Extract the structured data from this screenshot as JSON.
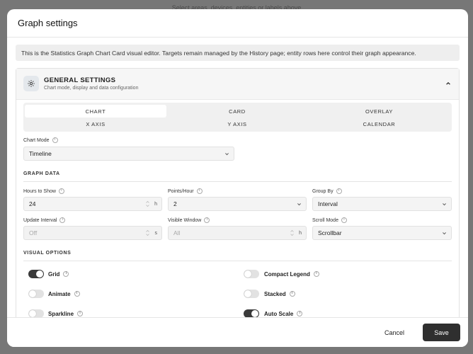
{
  "backdrop": {
    "hint_text": "Select areas, devices, entities or labels above"
  },
  "dialog": {
    "title": "Graph settings",
    "info_text": "This is the Statistics Graph Chart Card visual editor. Targets remain managed by the History page; entity rows here control their graph appearance."
  },
  "section": {
    "title": "GENERAL SETTINGS",
    "subtitle": "Chart mode, display and data configuration",
    "icon": "gear-icon",
    "collapse_icon": "chevron-up-icon"
  },
  "tabs": [
    {
      "label": "CHART",
      "active": true
    },
    {
      "label": "CARD",
      "active": false
    },
    {
      "label": "OVERLAY",
      "active": false
    },
    {
      "label": "X AXIS",
      "active": false
    },
    {
      "label": "Y AXIS",
      "active": false
    },
    {
      "label": "CALENDAR",
      "active": false
    }
  ],
  "chart_mode": {
    "label": "Chart Mode",
    "value": "Timeline"
  },
  "graph_data": {
    "title": "GRAPH DATA",
    "hours_to_show": {
      "label": "Hours to Show",
      "value": "24",
      "suffix": "h"
    },
    "points_per_hour": {
      "label": "Points/Hour",
      "value": "2"
    },
    "group_by": {
      "label": "Group By",
      "value": "Interval"
    },
    "update_interval": {
      "label": "Update Interval",
      "placeholder": "Off",
      "suffix": "s"
    },
    "visible_window": {
      "label": "Visible Window",
      "placeholder": "All",
      "suffix": "h"
    },
    "scroll_mode": {
      "label": "Scroll Mode",
      "value": "Scrollbar"
    }
  },
  "visual_options": {
    "title": "VISUAL OPTIONS",
    "toggles": [
      {
        "label": "Grid",
        "on": true
      },
      {
        "label": "Compact Legend",
        "on": false
      },
      {
        "label": "Animate",
        "on": false
      },
      {
        "label": "Stacked",
        "on": false
      },
      {
        "label": "Sparkline",
        "on": false
      },
      {
        "label": "Auto Scale",
        "on": true
      }
    ]
  },
  "footer": {
    "cancel_label": "Cancel",
    "save_label": "Save"
  },
  "colors": {
    "accent": "#2f2f2f",
    "toggle_on": "#3a3a3a",
    "toggle_off": "#e2e2e2",
    "backdrop": "#777777"
  }
}
